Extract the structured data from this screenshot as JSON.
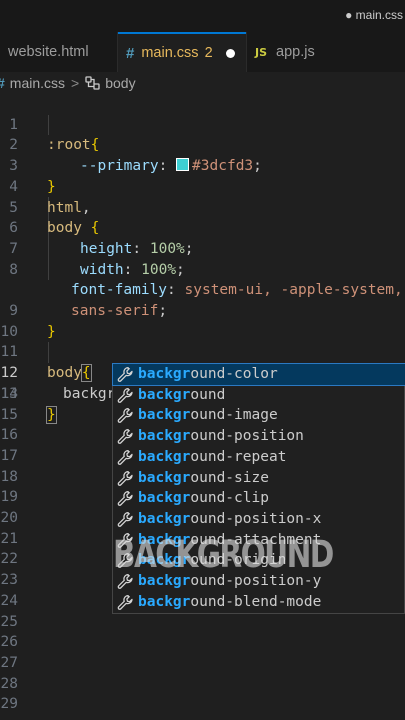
{
  "window": {
    "title": "● main.css"
  },
  "tabs": [
    {
      "label": "website.html",
      "active": false
    },
    {
      "icon": "#",
      "label": "main.css",
      "badge": "2",
      "active": true,
      "dirty": true
    },
    {
      "icon": "JS",
      "label": "app.js",
      "active": false
    }
  ],
  "breadcrumb": {
    "file": "main.css",
    "separator": ">",
    "symbol": "body",
    "file_icon": "css-hash-icon",
    "symbol_icon": "symbol-icon"
  },
  "editor": {
    "line_numbers": [
      "1",
      "2",
      "3",
      "4",
      "5",
      "6",
      "7",
      "8",
      "",
      "9",
      "10",
      "11",
      "12",
      "13",
      "14",
      "15",
      "16",
      "17",
      "18",
      "19",
      "20",
      "21",
      "22",
      "23",
      "24",
      "25",
      "26",
      "27",
      "28",
      "29"
    ],
    "code": {
      "l1_sel": ":root",
      "l1_brace": "{",
      "l2_prop": "--primary",
      "l2_colon": ":",
      "l2_val": "#3dcfd3",
      "l2_semi": ";",
      "l3_brace": "}",
      "l4_sel": "html",
      "l4_comma": ",",
      "l5_sel": "body",
      "l5_brace": "{",
      "l6_prop": "height",
      "l6_colon": ":",
      "l6_val": "100%",
      "l6_semi": ";",
      "l7_prop": "width",
      "l7_colon": ":",
      "l7_val": "100%",
      "l7_semi": ";",
      "l8_prop": "font-family",
      "l8_colon": ":",
      "l8_val": "system-ui, -apple-system, B",
      "l8b_val": "sans-serif",
      "l8b_semi": ";",
      "l9_brace": "}",
      "l11_sel": "body",
      "l11_brace": "{",
      "l12_typed": "backgr",
      "l13_brace": "}"
    },
    "swatch_color": "#3dcfd3"
  },
  "suggest": {
    "typed_prefix": "backgr",
    "items": [
      {
        "match": "backgr",
        "rest": "ound-color"
      },
      {
        "match": "backgr",
        "rest": "ound"
      },
      {
        "match": "backgr",
        "rest": "ound-image"
      },
      {
        "match": "backgr",
        "rest": "ound-position"
      },
      {
        "match": "backgr",
        "rest": "ound-repeat"
      },
      {
        "match": "backgr",
        "rest": "ound-size"
      },
      {
        "match": "backgr",
        "rest": "ound-clip"
      },
      {
        "match": "backgr",
        "rest": "ound-position-x"
      },
      {
        "match": "backgr",
        "rest": "ound-attachment"
      },
      {
        "match": "backgr",
        "rest": "ound-origin"
      },
      {
        "match": "backgr",
        "rest": "ound-position-y"
      },
      {
        "match": "backgr",
        "rest": "ound-blend-mode"
      }
    ],
    "item_icon": "wrench-icon"
  },
  "overlay": {
    "text": "BACKGROUND"
  },
  "colors": {
    "accent": "#0078d4",
    "match_highlight": "#2aaaff",
    "selection": "#04395e"
  }
}
